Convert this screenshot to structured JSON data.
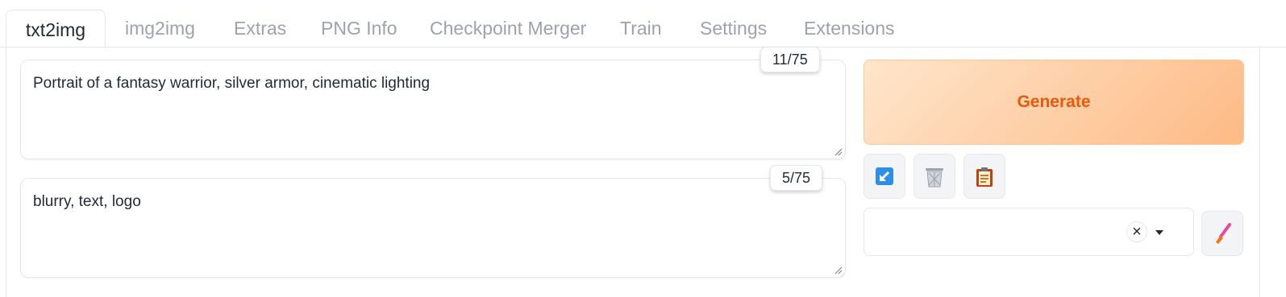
{
  "tabs": [
    {
      "label": "txt2img",
      "active": true
    },
    {
      "label": "img2img"
    },
    {
      "label": "Extras"
    },
    {
      "label": "PNG Info"
    },
    {
      "label": "Checkpoint Merger"
    },
    {
      "label": "Train"
    },
    {
      "label": "Settings"
    },
    {
      "label": "Extensions"
    }
  ],
  "prompt": {
    "value": "Portrait of a fantasy warrior, silver armor, cinematic lighting",
    "token_count": "11/75"
  },
  "negative_prompt": {
    "value": "blurry, text, logo",
    "token_count": "5/75"
  },
  "generate": {
    "label": "Generate"
  },
  "tool_buttons": [
    "read-generation-params-icon",
    "trash-icon",
    "clipboard-icon"
  ],
  "styles": {
    "selected": "",
    "clear_symbol": "×"
  },
  "colors": {
    "accent": "#ea580c",
    "generate_bg_start": "#ffe6cc",
    "generate_bg_end": "#fdba85"
  }
}
